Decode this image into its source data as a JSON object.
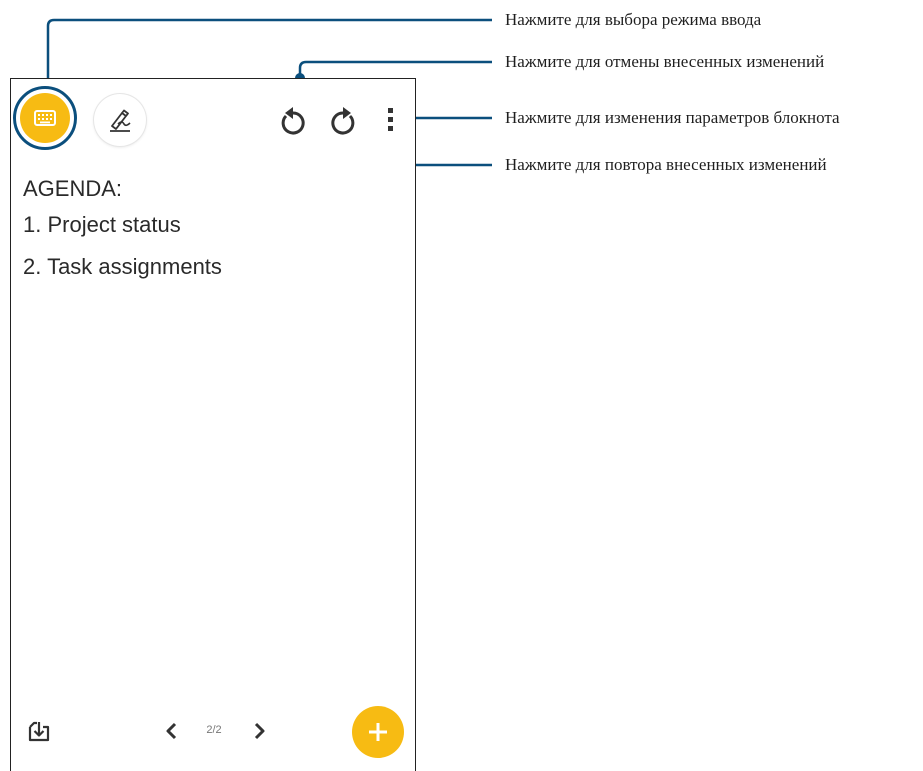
{
  "note": {
    "lines": [
      "AGENDA:",
      "1. Project status",
      "2. Task assignments"
    ]
  },
  "pager": {
    "page_indicator": "2/2"
  },
  "callouts": {
    "input_mode": "Нажмите для выбора режима ввода",
    "undo": "Нажмите для отмены внесенных изменений",
    "settings": "Нажмите для изменения параметров блокнота",
    "redo": "Нажмите для повтора внесенных изменений"
  },
  "colors": {
    "accent": "#f7bb13",
    "callout_line": "#0b4f7d",
    "icon": "#333333"
  },
  "icons": {
    "input_mode": "keyboard-icon",
    "handwriting": "pen-icon",
    "undo": "undo-icon",
    "redo": "redo-icon",
    "more": "more-vertical-icon",
    "import": "import-icon",
    "prev": "chevron-left-icon",
    "next": "chevron-right-icon",
    "add": "plus-icon"
  }
}
